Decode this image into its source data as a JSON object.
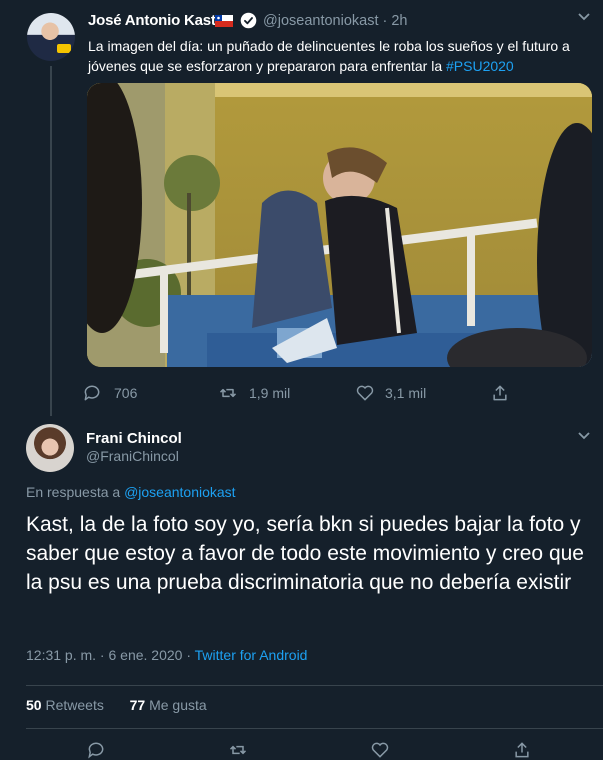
{
  "tweet": {
    "author_name": "José Antonio Kast",
    "handle": "@joseantoniokast",
    "time": "· 2h",
    "text_main": "La imagen del día: un puñado de delincuentes le roba los sueños y el futuro a jóvenes que se esforzaron y prepararon para enfrentar la ",
    "hashtag": "#PSU2020",
    "icons": [
      "chile-flag-icon",
      "verified-badge-icon",
      "chevron-down-icon"
    ],
    "actions": {
      "replies": "706",
      "retweets": "1,9 mil",
      "likes": "3,1 mil"
    }
  },
  "reply": {
    "author_name": "Frani Chincol",
    "handle": "@FraniChincol",
    "in_reply_prefix": "En respuesta a ",
    "in_reply_handle": "@joseantoniokast",
    "text": "Kast, la de la foto soy yo, sería bkn si puedes bajar la foto y saber que estoy a favor de todo este movimiento y creo que la psu es una prueba discriminatoria que no debería existir",
    "time": "12:31 p. m. · 6 ene. 2020 · ",
    "source": "Twitter for Android",
    "retweets_count": "50",
    "retweets_label": "Retweets",
    "likes_count": "77",
    "likes_label": "Me gusta"
  },
  "colors": {
    "background": "#15202b",
    "muted": "#8899a6",
    "accent": "#1da1f2",
    "divider": "#38444d"
  }
}
